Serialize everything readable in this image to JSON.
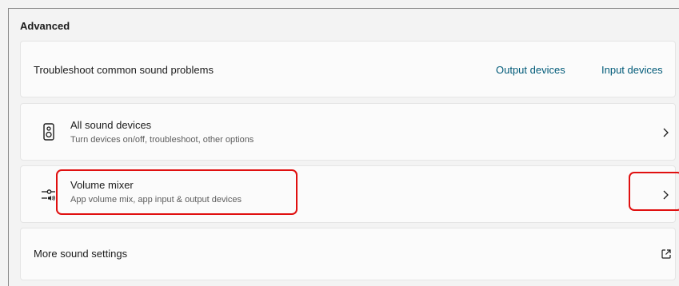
{
  "section": {
    "title": "Advanced"
  },
  "troubleshoot": {
    "label": "Troubleshoot common sound problems",
    "output_link": "Output devices",
    "input_link": "Input devices"
  },
  "all_devices": {
    "title": "All sound devices",
    "subtitle": "Turn devices on/off, troubleshoot, other options",
    "icon": "speaker-icon"
  },
  "volume_mixer": {
    "title": "Volume mixer",
    "subtitle": "App volume mix, app input & output devices",
    "icon": "volume-mixer-icon"
  },
  "more_settings": {
    "label": "More sound settings",
    "icon": "open-external-icon"
  },
  "colors": {
    "link": "#005a78",
    "highlight": "#e01010",
    "card_bg": "#fbfbfb",
    "page_bg": "#f3f3f3"
  }
}
